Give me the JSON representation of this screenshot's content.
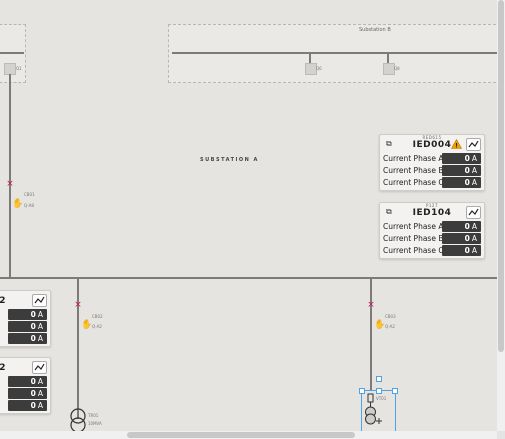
{
  "substation_b": {
    "title": "Substation B"
  },
  "section_label": "SUBSTATION A",
  "top_left_node": {
    "label": "Q1"
  },
  "top_nodes": [
    {
      "label": "Q6"
    },
    {
      "label": "Q8"
    }
  ],
  "feeders": [
    {
      "cb": "CB01",
      "code": "Q-A8"
    },
    {
      "cb": "CB02",
      "code": "Q-A2"
    },
    {
      "cb": "CB03",
      "code": "Q-A2"
    }
  ],
  "transformer": {
    "label": "TR01",
    "sub": "10MVA"
  },
  "generator": {
    "label": "VT01"
  },
  "ieds": [
    {
      "small": "RED615",
      "title": "IED004",
      "warning": true,
      "rows": [
        {
          "label": "Current Phase A",
          "value": "0",
          "unit": "A"
        },
        {
          "label": "Current Phase B",
          "value": "0",
          "unit": "A"
        },
        {
          "label": "Current Phase C",
          "value": "0",
          "unit": "A"
        }
      ]
    },
    {
      "small": "P127",
      "title": "IED104",
      "warning": false,
      "rows": [
        {
          "label": "Current Phase A",
          "value": "0",
          "unit": "A"
        },
        {
          "label": "Current Phase B",
          "value": "0",
          "unit": "A"
        },
        {
          "label": "Current Phase C",
          "value": "0",
          "unit": "A"
        }
      ]
    }
  ],
  "left_panels": [
    {
      "title": "2",
      "rows": [
        {
          "value": "0",
          "unit": "A"
        },
        {
          "value": "0",
          "unit": "A"
        },
        {
          "value": "0",
          "unit": "A"
        }
      ]
    },
    {
      "title": "2",
      "rows": [
        {
          "value": "0",
          "unit": "A"
        },
        {
          "value": "0",
          "unit": "A"
        },
        {
          "value": "0",
          "unit": "A"
        }
      ]
    }
  ],
  "icons": {
    "external": "external-link-icon",
    "warning": "warning-icon",
    "trend": "trend-chart-icon",
    "hand": "hand-icon",
    "breaker": "breaker-x-icon"
  },
  "colors": {
    "breaker": "#c2185b",
    "warning": "#f0a000",
    "selection": "#4ea3e6",
    "value_bg": "#3c3c3c"
  }
}
